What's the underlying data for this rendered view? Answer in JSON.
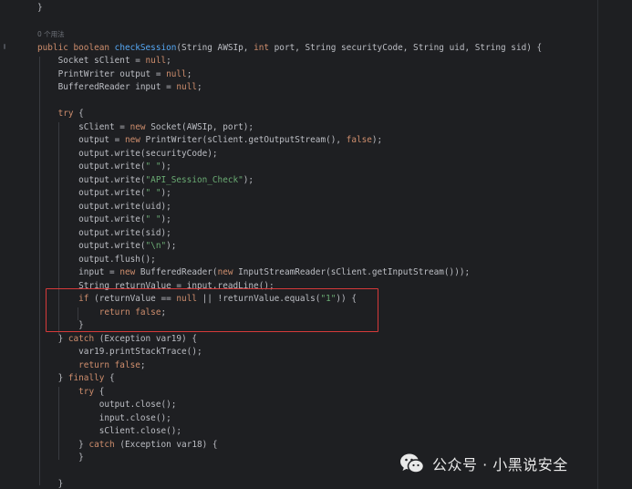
{
  "editor": {
    "usage_hint": "0 个用法",
    "method_name": "checkSession",
    "lines": [
      {
        "segments": [
          {
            "t": "}",
            "c": "plain"
          }
        ]
      },
      {
        "segments": []
      },
      {
        "segments": [
          {
            "t": "0 个用法",
            "c": "usage-hint"
          }
        ]
      },
      {
        "segments": [
          {
            "t": "public boolean ",
            "c": "kw"
          },
          {
            "t": "checkSession",
            "c": "fn"
          },
          {
            "t": "(String AWSIp, ",
            "c": "plain"
          },
          {
            "t": "int",
            "c": "kw"
          },
          {
            "t": " port, String securityCode, String uid, String sid) {",
            "c": "plain"
          }
        ]
      },
      {
        "segments": [
          {
            "t": "    Socket sClient = ",
            "c": "plain"
          },
          {
            "t": "null",
            "c": "kw"
          },
          {
            "t": ";",
            "c": "plain"
          }
        ]
      },
      {
        "segments": [
          {
            "t": "    PrintWriter output = ",
            "c": "plain"
          },
          {
            "t": "null",
            "c": "kw"
          },
          {
            "t": ";",
            "c": "plain"
          }
        ]
      },
      {
        "segments": [
          {
            "t": "    BufferedReader input = ",
            "c": "plain"
          },
          {
            "t": "null",
            "c": "kw"
          },
          {
            "t": ";",
            "c": "plain"
          }
        ]
      },
      {
        "segments": []
      },
      {
        "segments": [
          {
            "t": "    ",
            "c": "plain"
          },
          {
            "t": "try",
            "c": "kw"
          },
          {
            "t": " {",
            "c": "plain"
          }
        ]
      },
      {
        "segments": [
          {
            "t": "        sClient = ",
            "c": "plain"
          },
          {
            "t": "new",
            "c": "kw"
          },
          {
            "t": " Socket(AWSIp, port);",
            "c": "plain"
          }
        ]
      },
      {
        "segments": [
          {
            "t": "        output = ",
            "c": "plain"
          },
          {
            "t": "new",
            "c": "kw"
          },
          {
            "t": " PrintWriter(sClient.getOutputStream(), ",
            "c": "plain"
          },
          {
            "t": "false",
            "c": "kw"
          },
          {
            "t": ");",
            "c": "plain"
          }
        ]
      },
      {
        "segments": [
          {
            "t": "        output.write(securityCode);",
            "c": "plain"
          }
        ]
      },
      {
        "segments": [
          {
            "t": "        output.write(",
            "c": "plain"
          },
          {
            "t": "\" \"",
            "c": "str"
          },
          {
            "t": ");",
            "c": "plain"
          }
        ]
      },
      {
        "segments": [
          {
            "t": "        output.write(",
            "c": "plain"
          },
          {
            "t": "\"API_Session_Check\"",
            "c": "str"
          },
          {
            "t": ");",
            "c": "plain"
          }
        ]
      },
      {
        "segments": [
          {
            "t": "        output.write(",
            "c": "plain"
          },
          {
            "t": "\" \"",
            "c": "str"
          },
          {
            "t": ");",
            "c": "plain"
          }
        ]
      },
      {
        "segments": [
          {
            "t": "        output.write(uid);",
            "c": "plain"
          }
        ]
      },
      {
        "segments": [
          {
            "t": "        output.write(",
            "c": "plain"
          },
          {
            "t": "\" \"",
            "c": "str"
          },
          {
            "t": ");",
            "c": "plain"
          }
        ]
      },
      {
        "segments": [
          {
            "t": "        output.write(sid);",
            "c": "plain"
          }
        ]
      },
      {
        "segments": [
          {
            "t": "        output.write(",
            "c": "plain"
          },
          {
            "t": "\"\\n\"",
            "c": "str"
          },
          {
            "t": ");",
            "c": "plain"
          }
        ]
      },
      {
        "segments": [
          {
            "t": "        output.flush();",
            "c": "plain"
          }
        ]
      },
      {
        "segments": [
          {
            "t": "        input = ",
            "c": "plain"
          },
          {
            "t": "new",
            "c": "kw"
          },
          {
            "t": " BufferedReader(",
            "c": "plain"
          },
          {
            "t": "new",
            "c": "kw"
          },
          {
            "t": " InputStreamReader(sClient.getInputStream()));",
            "c": "plain"
          }
        ]
      },
      {
        "segments": [
          {
            "t": "        String returnValue = input.readLine();",
            "c": "plain"
          }
        ]
      },
      {
        "segments": [
          {
            "t": "        ",
            "c": "plain"
          },
          {
            "t": "if",
            "c": "kw"
          },
          {
            "t": " (returnValue == ",
            "c": "plain"
          },
          {
            "t": "null",
            "c": "kw"
          },
          {
            "t": " || !returnValue.equals(",
            "c": "plain"
          },
          {
            "t": "\"1\"",
            "c": "str"
          },
          {
            "t": ")) {",
            "c": "plain"
          }
        ]
      },
      {
        "segments": [
          {
            "t": "            ",
            "c": "plain"
          },
          {
            "t": "return false",
            "c": "kw"
          },
          {
            "t": ";",
            "c": "plain"
          }
        ]
      },
      {
        "segments": [
          {
            "t": "        }",
            "c": "plain"
          }
        ]
      },
      {
        "segments": [
          {
            "t": "    } ",
            "c": "plain"
          },
          {
            "t": "catch",
            "c": "kw"
          },
          {
            "t": " (Exception var19) {",
            "c": "plain"
          }
        ]
      },
      {
        "segments": [
          {
            "t": "        var19.printStackTrace();",
            "c": "plain"
          }
        ]
      },
      {
        "segments": [
          {
            "t": "        ",
            "c": "plain"
          },
          {
            "t": "return false",
            "c": "kw"
          },
          {
            "t": ";",
            "c": "plain"
          }
        ]
      },
      {
        "segments": [
          {
            "t": "    } ",
            "c": "plain"
          },
          {
            "t": "finally",
            "c": "kw"
          },
          {
            "t": " {",
            "c": "plain"
          }
        ]
      },
      {
        "segments": [
          {
            "t": "        ",
            "c": "plain"
          },
          {
            "t": "try",
            "c": "kw"
          },
          {
            "t": " {",
            "c": "plain"
          }
        ]
      },
      {
        "segments": [
          {
            "t": "            output.close();",
            "c": "plain"
          }
        ]
      },
      {
        "segments": [
          {
            "t": "            input.close();",
            "c": "plain"
          }
        ]
      },
      {
        "segments": [
          {
            "t": "            sClient.close();",
            "c": "plain"
          }
        ]
      },
      {
        "segments": [
          {
            "t": "        } ",
            "c": "plain"
          },
          {
            "t": "catch",
            "c": "kw"
          },
          {
            "t": " (Exception var18) {",
            "c": "plain"
          }
        ]
      },
      {
        "segments": [
          {
            "t": "        }",
            "c": "plain"
          }
        ]
      },
      {
        "segments": []
      },
      {
        "segments": [
          {
            "t": "    }",
            "c": "plain"
          }
        ]
      }
    ]
  },
  "watermark": {
    "text": "公众号 · 小黑说安全",
    "icon": "wechat-icon"
  },
  "colors": {
    "background": "#1e1f22",
    "keyword": "#cf8e6d",
    "function": "#56a8f5",
    "string": "#6aab73",
    "text": "#bcbec4",
    "highlight_border": "#d63a3a"
  }
}
